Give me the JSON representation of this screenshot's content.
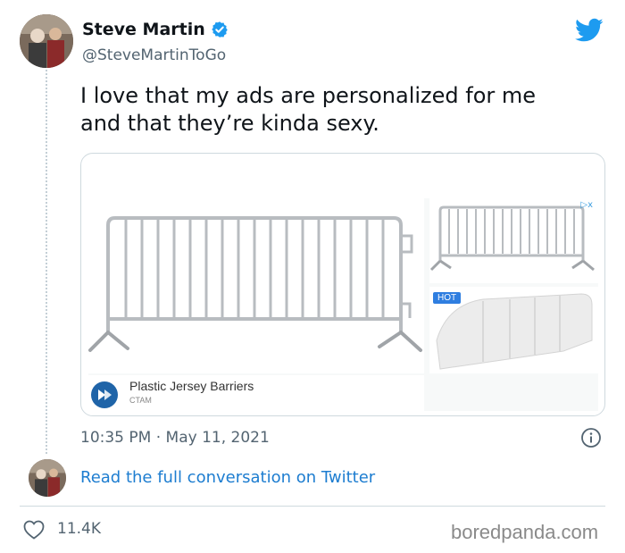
{
  "author": {
    "display_name": "Steve Martin",
    "handle": "@SteveMartinToGo",
    "verified": true
  },
  "tweet": {
    "text_line1": "I love that my ads are personalized for me",
    "text_line2": "and that they’re kinda sexy.",
    "timestamp": "10:35 PM · May 11, 2021"
  },
  "ad": {
    "title": "Plastic Jersey Barriers",
    "advertiser": "CTAM",
    "badge": "HOT",
    "adchoices": "▷x"
  },
  "footer": {
    "read_link": "Read the full conversation on Twitter",
    "like_count": "11.4K",
    "watermark": "boredpanda.com"
  },
  "colors": {
    "link": "#1d7dd0",
    "verified": "#1d9bf0",
    "twitter_bird": "#1d9bf0",
    "muted_text": "#536471"
  },
  "icons": {
    "verified": "verified-badge-icon",
    "bird": "twitter-bird-icon",
    "info": "info-icon",
    "like": "heart-icon"
  }
}
